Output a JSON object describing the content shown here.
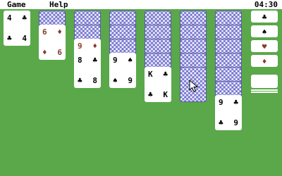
{
  "menu": {
    "game_label": "Game",
    "help_label": "Help",
    "clock": "04:30"
  },
  "suits": {
    "club": "♣",
    "spade": "♠",
    "heart": "♥",
    "diamond": "♦"
  },
  "colors": {
    "felt": "#5aa84a",
    "red_suit": "#8b3a2c",
    "card_back": "#a6a6e2"
  },
  "waste": {
    "rank": "4",
    "suit": "♣"
  },
  "tableau": [
    {
      "hidden": 1,
      "face_up": [
        {
          "rank": "6",
          "suit": "♦",
          "color": "red"
        }
      ]
    },
    {
      "hidden": 2,
      "face_up": [
        {
          "rank": "9",
          "suit": "♦",
          "color": "red"
        },
        {
          "rank": "8",
          "suit": "♣",
          "color": "black"
        }
      ]
    },
    {
      "hidden": 3,
      "face_up": [
        {
          "rank": "9",
          "suit": "♠",
          "color": "black"
        }
      ]
    },
    {
      "hidden": 4,
      "face_up": [
        {
          "rank": "K",
          "suit": "♣",
          "color": "black"
        }
      ]
    },
    {
      "hidden": 5,
      "face_up": []
    },
    {
      "hidden": 6,
      "face_up": [
        {
          "rank": "9",
          "suit": "♣",
          "color": "black"
        }
      ]
    }
  ],
  "foundations": [
    {
      "suit": "♣",
      "color": "black"
    },
    {
      "suit": "♠",
      "color": "black"
    },
    {
      "suit": "♥",
      "color": "red"
    },
    {
      "suit": "♦",
      "color": "red"
    }
  ]
}
